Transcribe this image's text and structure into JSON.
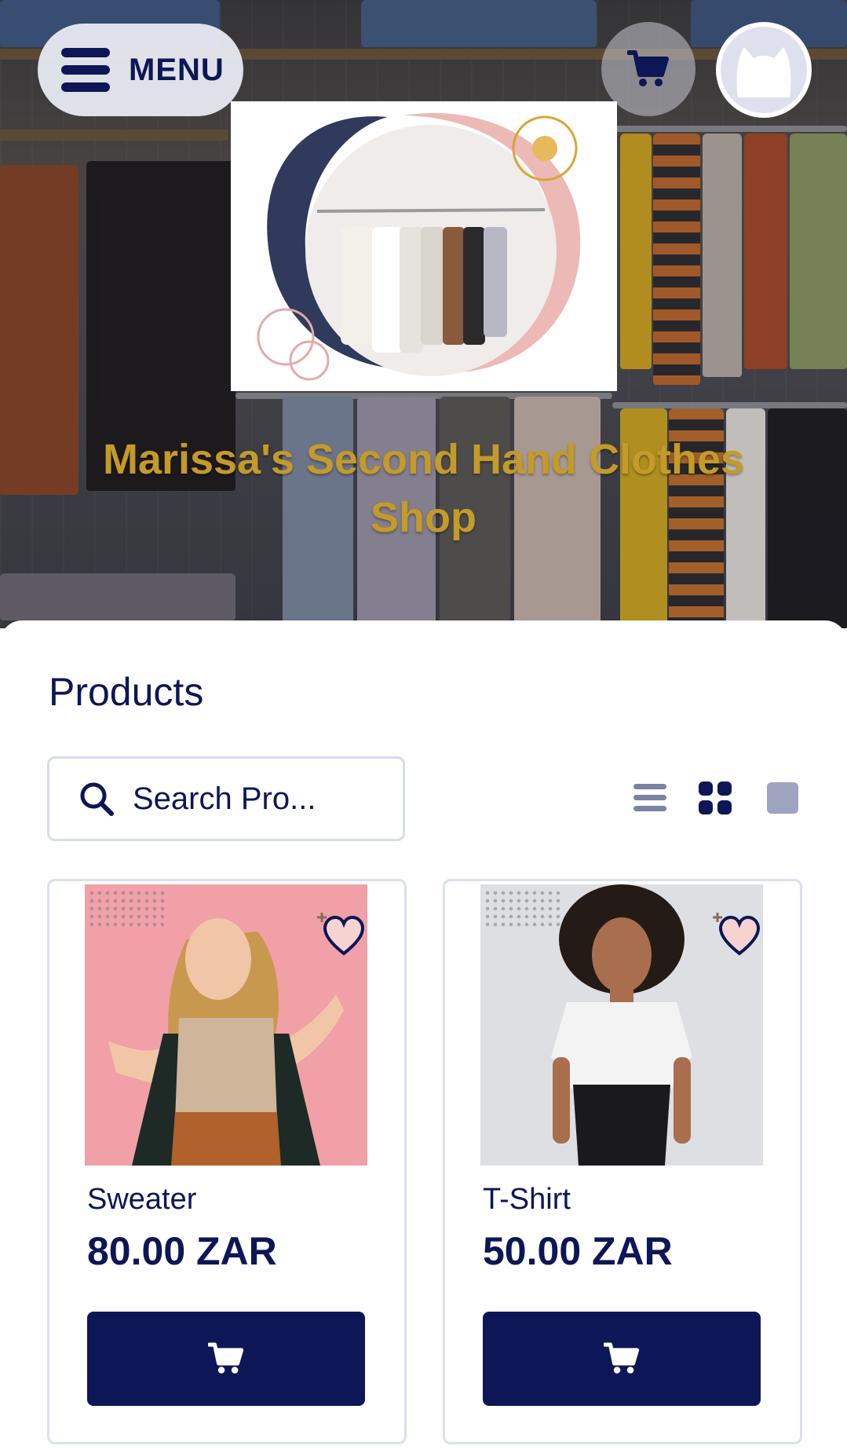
{
  "header": {
    "menu_label": "MENU",
    "shop_title": "Marissa's Second Hand Clothes Shop"
  },
  "icons": {
    "menu": "hamburger-icon",
    "cart": "shopping-cart-icon",
    "avatar": "user-avatar-icon",
    "search": "search-icon",
    "view_list": "list-view-icon",
    "view_grid": "grid-view-icon",
    "view_single": "single-view-icon",
    "favorite": "heart-icon"
  },
  "colors": {
    "primary": "#0d1656",
    "title_gold": "#c49a2a",
    "border": "#dbe0ee"
  },
  "main": {
    "section_title": "Products",
    "search": {
      "value": "Search Pro..."
    },
    "view_selected": "grid",
    "products": [
      {
        "name": "Sweater",
        "price": "80.00 ZAR",
        "photo_background": "#f0a0a6"
      },
      {
        "name": "T-Shirt",
        "price": "50.00 ZAR",
        "photo_background": "#dedfe3"
      }
    ]
  }
}
